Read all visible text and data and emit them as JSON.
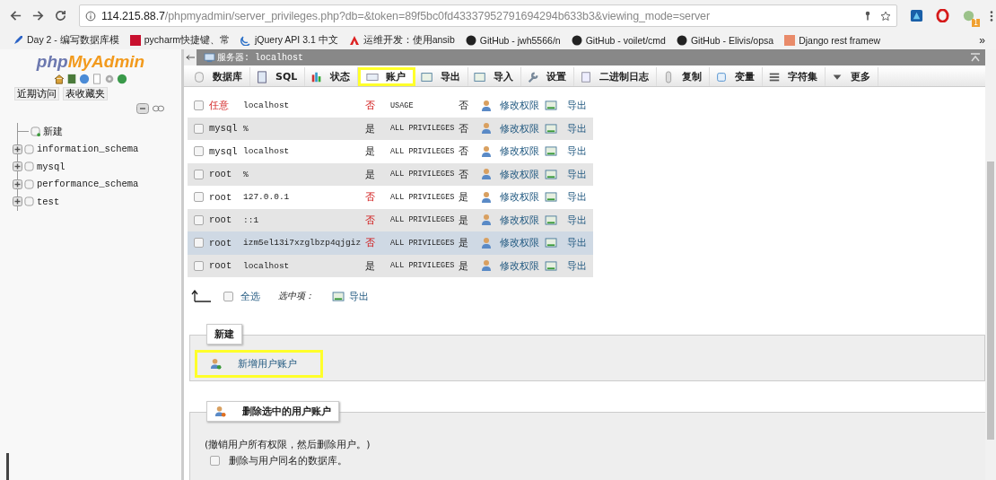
{
  "browser": {
    "url_host": "114.215.88.7",
    "url_path": "/phpmyadmin/server_privileges.php?db=&token=89f5bc0fd43337952791694294b633b3&viewing_mode=server",
    "bookmarks": [
      "Day 2 - 编写数据库模",
      "pycharm快捷键、常",
      "jQuery API 3.1 中文",
      "运维开发：使用ansib",
      "GitHub - jwh5566/n",
      "GitHub - voilet/cmd",
      "GitHub - Elivis/opsa",
      "Django rest framew"
    ],
    "more": "»",
    "badge": "1"
  },
  "sidebar": {
    "logo_part_1": "php",
    "logo_part_2": "MyAdmin",
    "buttons": [
      "近期访问",
      "表收藏夹"
    ],
    "tree": [
      {
        "label": "新建",
        "kind": "new"
      },
      {
        "label": "information_schema",
        "kind": "db",
        "expanded": false
      },
      {
        "label": "mysql",
        "kind": "db",
        "expanded": false
      },
      {
        "label": "performance_schema",
        "kind": "db",
        "expanded": false
      },
      {
        "label": "test",
        "kind": "db",
        "expanded": false
      }
    ]
  },
  "breadcrumb": "服务器: localhost",
  "tabs": [
    {
      "label": "数据库",
      "selected": false
    },
    {
      "label": "SQL",
      "selected": false
    },
    {
      "label": "状态",
      "selected": false
    },
    {
      "label": "账户",
      "selected": true
    },
    {
      "label": "导出",
      "selected": false
    },
    {
      "label": "导入",
      "selected": false
    },
    {
      "label": "设置",
      "selected": false
    },
    {
      "label": "二进制日志",
      "selected": false
    },
    {
      "label": "复制",
      "selected": false
    },
    {
      "label": "变量",
      "selected": false
    },
    {
      "label": "字符集",
      "selected": false
    },
    {
      "label": "更多",
      "selected": false
    }
  ],
  "rows": [
    {
      "user": "任意",
      "any_user": true,
      "host": "localhost",
      "password": "否",
      "has_password": false,
      "privileges": "USAGE",
      "grant": "否",
      "edit": "修改权限",
      "export": "导出",
      "checked": false,
      "highlighted": false
    },
    {
      "user": "mysql",
      "any_user": false,
      "host": "%",
      "password": "是",
      "has_password": true,
      "privileges": "ALL PRIVILEGES",
      "grant": "否",
      "edit": "修改权限",
      "export": "导出",
      "checked": false,
      "highlighted": false
    },
    {
      "user": "mysql",
      "any_user": false,
      "host": "localhost",
      "password": "是",
      "has_password": true,
      "privileges": "ALL PRIVILEGES",
      "grant": "否",
      "edit": "修改权限",
      "export": "导出",
      "checked": false,
      "highlighted": false
    },
    {
      "user": "root",
      "any_user": false,
      "host": "%",
      "password": "是",
      "has_password": true,
      "privileges": "ALL PRIVILEGES",
      "grant": "否",
      "edit": "修改权限",
      "export": "导出",
      "checked": false,
      "highlighted": false
    },
    {
      "user": "root",
      "any_user": false,
      "host": "127.0.0.1",
      "password": "否",
      "has_password": false,
      "privileges": "ALL PRIVILEGES",
      "grant": "是",
      "edit": "修改权限",
      "export": "导出",
      "checked": false,
      "highlighted": false
    },
    {
      "user": "root",
      "any_user": false,
      "host": "::1",
      "password": "否",
      "has_password": false,
      "privileges": "ALL PRIVILEGES",
      "grant": "是",
      "edit": "修改权限",
      "export": "导出",
      "checked": false,
      "highlighted": false
    },
    {
      "user": "root",
      "any_user": false,
      "host": "izm5el13i7xzglbzp4qjgiz",
      "password": "否",
      "has_password": false,
      "privileges": "ALL PRIVILEGES",
      "grant": "是",
      "edit": "修改权限",
      "export": "导出",
      "checked": false,
      "highlighted": true
    },
    {
      "user": "root",
      "any_user": false,
      "host": "localhost",
      "password": "是",
      "has_password": true,
      "privileges": "ALL PRIVILEGES",
      "grant": "是",
      "edit": "修改权限",
      "export": "导出",
      "checked": false,
      "highlighted": false
    }
  ],
  "bulk": {
    "select_all": "全选",
    "checked": false,
    "with_selected": "选中项：",
    "export": "导出"
  },
  "new_section": {
    "legend": "新建",
    "link": "新增用户账户",
    "highlighted": true
  },
  "delete_section": {
    "legend": "删除选中的用户账户",
    "note": "(撤销用户所有权限，然后删除用户。)",
    "option": "删除与用户同名的数据库。",
    "checked": false
  }
}
